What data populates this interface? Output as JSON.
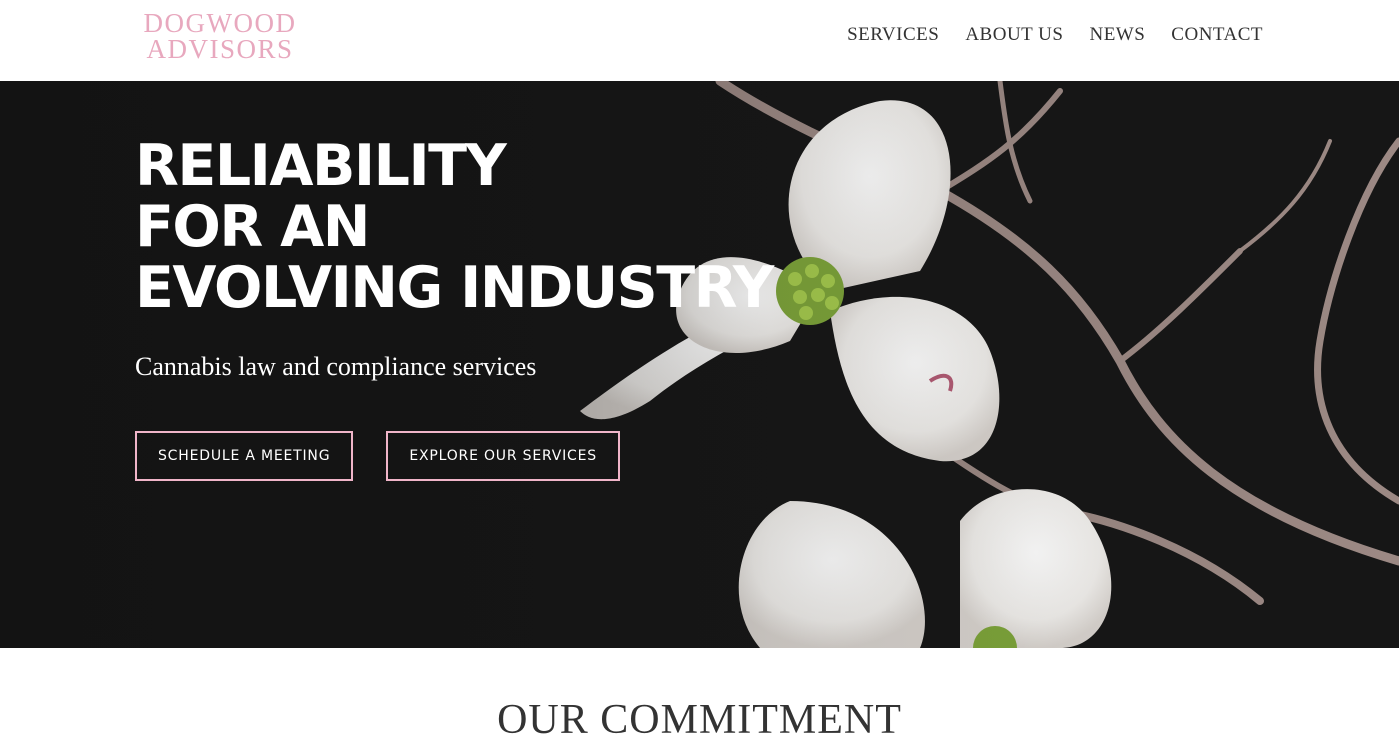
{
  "logo": {
    "line1": "DOGWOOD",
    "line2": "ADVISORS"
  },
  "nav": {
    "items": [
      "SERVICES",
      "ABOUT US",
      "NEWS",
      "CONTACT"
    ]
  },
  "hero": {
    "headline": [
      "RELIABILITY",
      "FOR AN",
      "EVOLVING INDUSTRY"
    ],
    "subtitle": "Cannabis law and compliance services",
    "buttons": [
      "SCHEDULE A MEETING",
      "EXPLORE OUR SERVICES"
    ]
  },
  "commitment": {
    "heading": "OUR COMMITMENT"
  },
  "colors": {
    "brand_pink": "#e8a8be",
    "button_border": "#f0b5c9",
    "hero_bg": "#141414",
    "text_dark": "#333333"
  }
}
